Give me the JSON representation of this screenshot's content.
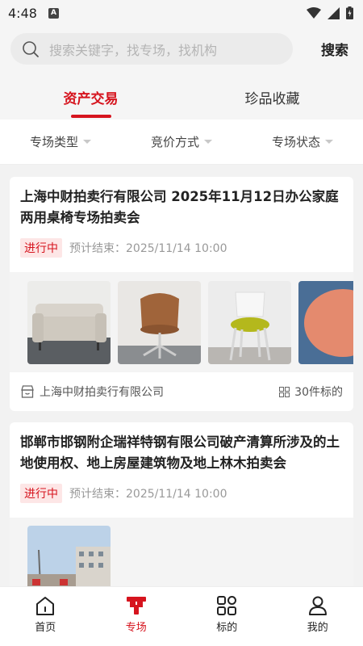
{
  "status_bar": {
    "time": "4:48",
    "notification_glyph": "A"
  },
  "search": {
    "placeholder": "搜索关键字，找专场，找机构",
    "button_label": "搜索"
  },
  "tabs": [
    {
      "label": "资产交易",
      "active": true
    },
    {
      "label": "珍品收藏",
      "active": false
    }
  ],
  "filters": [
    {
      "label": "专场类型"
    },
    {
      "label": "竞价方式"
    },
    {
      "label": "专场状态"
    }
  ],
  "cards": [
    {
      "title": "上海中财拍卖行有限公司 2025年11月12日办公家庭两用桌椅专场拍卖会",
      "status": "进行中",
      "end_time": "预计结束：2025/11/14 10:00",
      "organization": "上海中财拍卖行有限公司",
      "lot_count": "30件标的"
    },
    {
      "title": "邯郸市邯钢附企瑞祥特钢有限公司破产清算所涉及的土地使用权、地上房屋建筑物及地上林木拍卖会",
      "status": "进行中",
      "end_time": "预计结束：2025/11/14 10:00"
    }
  ],
  "bottom_nav": [
    {
      "label": "首页",
      "icon": "home-icon",
      "active": false
    },
    {
      "label": "专场",
      "icon": "gavel-icon",
      "active": true
    },
    {
      "label": "标的",
      "icon": "grid-icon",
      "active": false
    },
    {
      "label": "我的",
      "icon": "user-icon",
      "active": false
    }
  ],
  "colors": {
    "accent": "#d6141e",
    "badge_bg": "#fde6e6",
    "background": "#f2f2f2"
  }
}
